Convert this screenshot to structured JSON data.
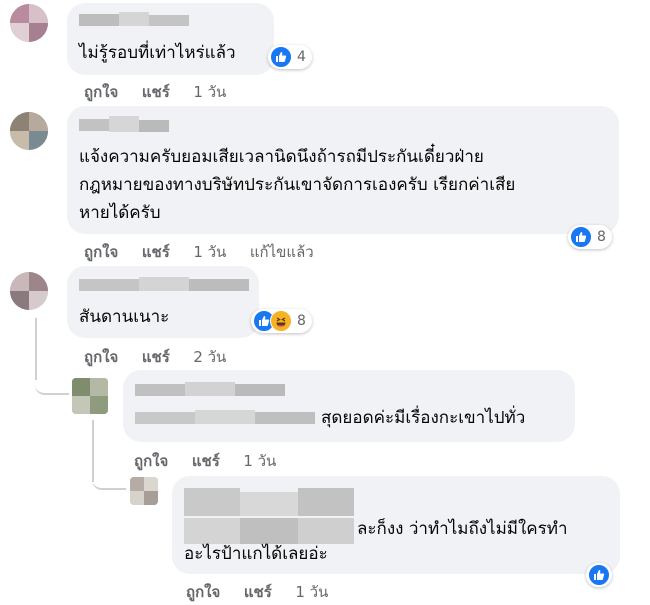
{
  "comments": [
    {
      "text_lines": [
        "ไม่รู้รอบที่เท่าไหร่แล้ว"
      ],
      "like_label": "ถูกใจ",
      "share_label": "แชร์",
      "time": "1 วัน",
      "reaction_count": "4"
    },
    {
      "text_lines": [
        "แจ้งความครับยอมเสียเวลานิดนึงถ้ารถมีประกันเดี๋ยวฝ่าย",
        "กฎหมายของทางบริษัทประกันเขาจัดการเองครับ เรียกค่าเสีย",
        "หายได้ครับ"
      ],
      "like_label": "ถูกใจ",
      "share_label": "แชร์",
      "time": "1 วัน",
      "edited_label": "แก้ไขแล้ว",
      "reaction_count": "8"
    },
    {
      "text_lines": [
        "สันดานเนาะ"
      ],
      "like_label": "ถูกใจ",
      "share_label": "แชร์",
      "time": "2 วัน",
      "reaction_count": "8"
    }
  ],
  "replies": [
    {
      "text_lines": [
        "สุดยอดค่ะมีเรื่องกะเขาไปทั่ว"
      ],
      "like_label": "ถูกใจ",
      "share_label": "แชร์",
      "time": "1 วัน"
    },
    {
      "text_lines": [
        "ละก็งง ว่าทำไมถึงไม่มีใครทำ",
        "อะไรป้าแกได้เลยอ่ะ"
      ],
      "like_label": "ถูกใจ",
      "share_label": "แชร์",
      "time": "1 วัน"
    }
  ],
  "icons": {
    "like": "like-thumb-icon",
    "haha": "haha-face-icon"
  },
  "colors": {
    "bubble": "#f0f2f5",
    "like_blue": "#1877f2",
    "haha_yellow": "#f7b125",
    "meta_text": "#65676b"
  }
}
